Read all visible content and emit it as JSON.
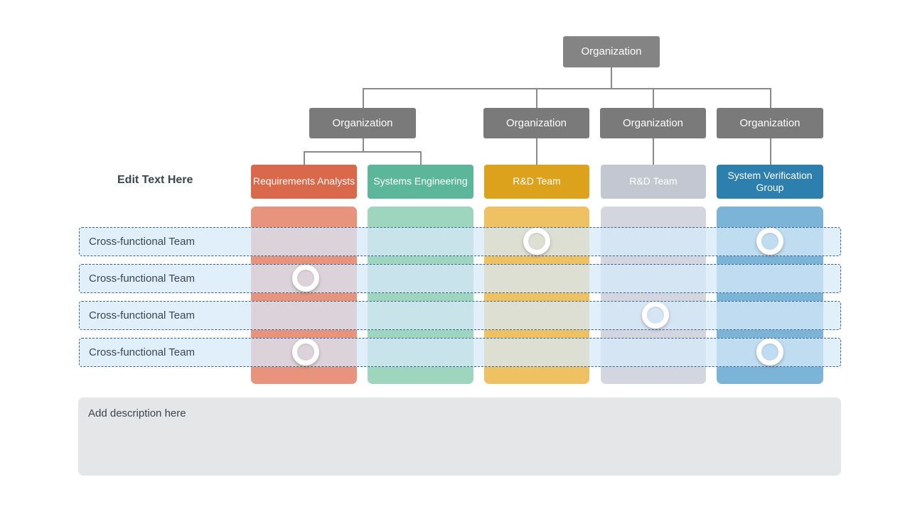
{
  "slide": {
    "side_label": "Edit Text Here",
    "description_placeholder": "Add description here"
  },
  "colors": {
    "org_box": "#7a7a7a",
    "org_root": "#848484",
    "connector": "#8a8a8a",
    "row_fill": "#d6eaf9",
    "row_border": "#35628f",
    "description_panel": "#e5e6e7",
    "text_dark": "#3c4450"
  },
  "hierarchy": {
    "root": {
      "label": "Organization"
    },
    "level2": [
      {
        "label": "Organization"
      },
      {
        "label": "Organization"
      },
      {
        "label": "Organization"
      },
      {
        "label": "Organization"
      }
    ]
  },
  "teams": [
    {
      "label": "Requirements Analysts",
      "color": "#d9694a",
      "band_color": "#e8937c"
    },
    {
      "label": "Systems Engineering",
      "color": "#5cb79a",
      "band_color": "#9ed5bf"
    },
    {
      "label": "R&D Team",
      "color": "#dda21c",
      "band_color": "#eec262"
    },
    {
      "label": "R&D Team",
      "color": "#c3c7d2",
      "band_color": "#d3d6df"
    },
    {
      "label": "System Verification Group",
      "color": "#2d7fad",
      "band_color": "#7cb4d8"
    }
  ],
  "cross_functional_rows": [
    {
      "label": "Cross-functional Team",
      "marked_columns": [
        3,
        5
      ]
    },
    {
      "label": "Cross-functional Team",
      "marked_columns": [
        1
      ]
    },
    {
      "label": "Cross-functional Team",
      "marked_columns": [
        4
      ]
    },
    {
      "label": "Cross-functional Team",
      "marked_columns": [
        1,
        5
      ]
    }
  ]
}
